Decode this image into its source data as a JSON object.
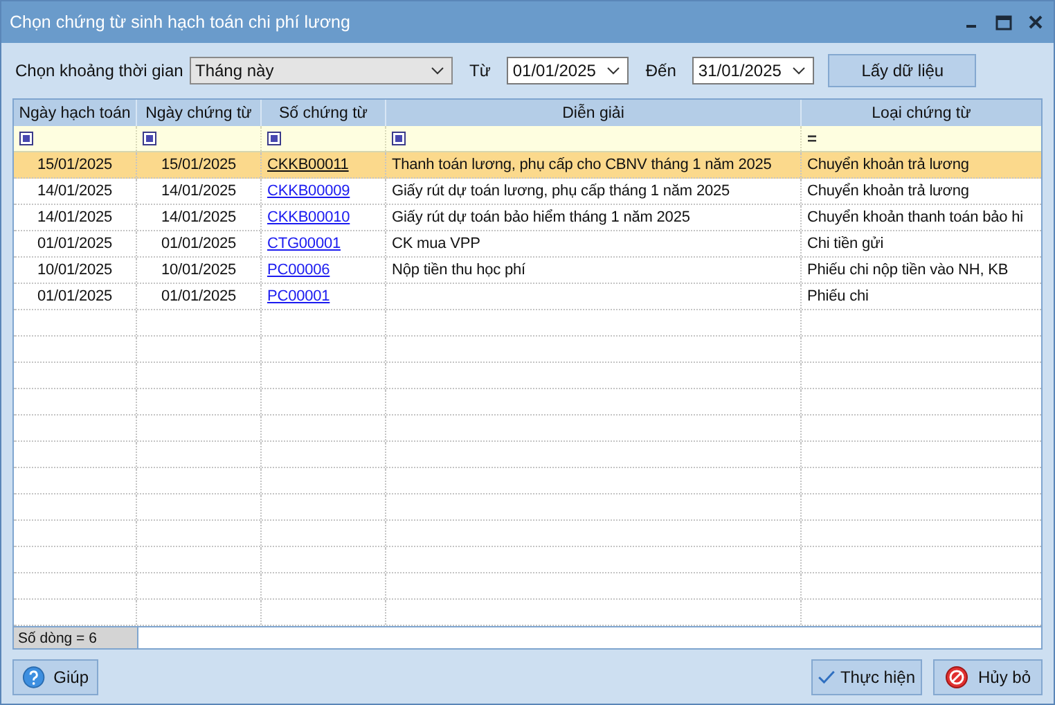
{
  "window": {
    "title": "Chọn chứng từ sinh hạch toán chi phí lương"
  },
  "toolbar": {
    "period_label": "Chọn khoảng thời gian",
    "period_value": "Tháng này",
    "from_label": "Từ",
    "from_value": "01/01/2025",
    "to_label": "Đến",
    "to_value": "31/01/2025",
    "fetch_button": "Lấy dữ liệu"
  },
  "table": {
    "columns": [
      "Ngày hạch toán",
      "Ngày chứng từ",
      "Số chứng từ",
      "Diễn giải",
      "Loại chứng từ"
    ],
    "filters": [
      {
        "kind": "square"
      },
      {
        "kind": "square"
      },
      {
        "kind": "square"
      },
      {
        "kind": "square"
      },
      {
        "kind": "operator",
        "text": "="
      }
    ],
    "rows": [
      {
        "posting_date": "15/01/2025",
        "doc_date": "15/01/2025",
        "doc_no": "CKKB00011",
        "description": "Thanh toán lương, phụ cấp cho CBNV tháng 1 năm 2025",
        "doc_type": "Chuyển khoản trả lương",
        "selected": true
      },
      {
        "posting_date": "14/01/2025",
        "doc_date": "14/01/2025",
        "doc_no": "CKKB00009",
        "description": "Giấy rút dự toán lương, phụ cấp tháng 1 năm 2025",
        "doc_type": "Chuyển khoản trả lương",
        "selected": false
      },
      {
        "posting_date": "14/01/2025",
        "doc_date": "14/01/2025",
        "doc_no": "CKKB00010",
        "description": "Giấy rút dự toán bảo hiểm tháng 1 năm 2025",
        "doc_type": "Chuyển khoản thanh toán bảo hi",
        "selected": false
      },
      {
        "posting_date": "01/01/2025",
        "doc_date": "01/01/2025",
        "doc_no": "CTG00001",
        "description": "CK mua VPP",
        "doc_type": "Chi tiền gửi",
        "selected": false
      },
      {
        "posting_date": "10/01/2025",
        "doc_date": "10/01/2025",
        "doc_no": "PC00006",
        "description": "Nộp tiền thu học phí",
        "doc_type": "Phiếu chi nộp tiền vào NH, KB",
        "selected": false
      },
      {
        "posting_date": "01/01/2025",
        "doc_date": "01/01/2025",
        "doc_no": "PC00001",
        "description": "",
        "doc_type": "Phiếu chi",
        "selected": false
      }
    ],
    "footer": "Số dòng = 6"
  },
  "buttons": {
    "help": "Giúp",
    "execute": "Thực hiện",
    "cancel": "Hủy bỏ"
  }
}
